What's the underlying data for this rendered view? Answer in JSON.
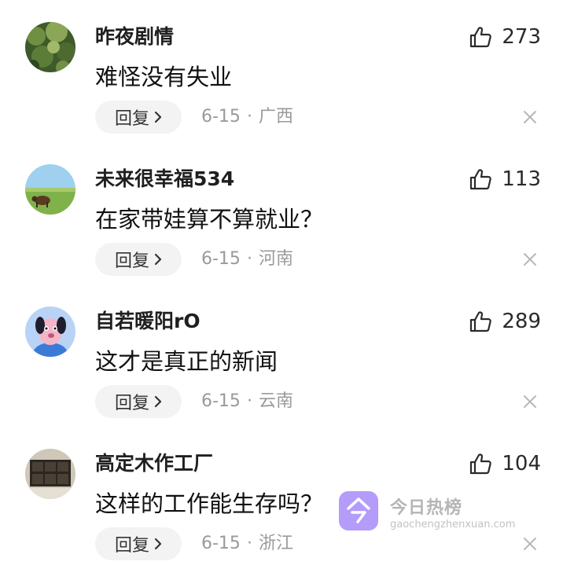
{
  "comments": [
    {
      "username": "昨夜剧情",
      "text": "难怪没有失业",
      "likes": "273",
      "reply_label": "回复",
      "date": "6-15",
      "separator": "·",
      "location": "广西",
      "avatar_icon": "green-plant-avatar"
    },
    {
      "username": "未来很幸福534",
      "text": "在家带娃算不算就业？",
      "likes": "113",
      "reply_label": "回复",
      "date": "6-15",
      "separator": "·",
      "location": "河南",
      "avatar_icon": "grassland-cow-avatar"
    },
    {
      "username": "自若暖阳rO",
      "text": "这才是真正的新闻",
      "likes": "289",
      "reply_label": "回复",
      "date": "6-15",
      "separator": "·",
      "location": "云南",
      "avatar_icon": "cartoon-dog-avatar"
    },
    {
      "username": "高定木作工厂",
      "text": "这样的工作能生存吗？",
      "likes": "104",
      "reply_label": "回复",
      "date": "6-15",
      "separator": "·",
      "location": "浙江",
      "avatar_icon": "wood-cabinet-avatar"
    }
  ],
  "watermark": {
    "name": "今日热榜",
    "url": "gaochengzhenxuan.com",
    "logo_color": "#a78bfa"
  },
  "colors": {
    "username": "#1f1f1f",
    "meta": "#9a9a9a",
    "reply_bg": "#f3f3f3"
  }
}
